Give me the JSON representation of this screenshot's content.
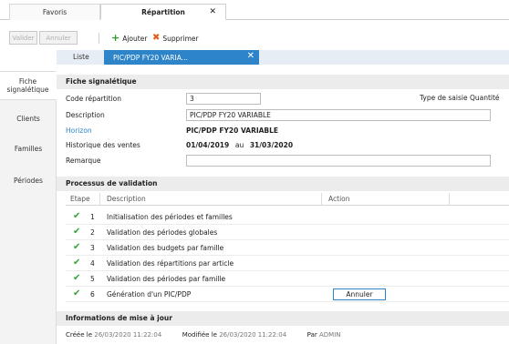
{
  "tabs": {
    "favoris": "Favoris",
    "repartition": "Répartition",
    "close": "✕"
  },
  "toolbar": {
    "valider": "Valider",
    "annuler": "Annuler",
    "ajouter": "Ajouter",
    "supprimer": "Supprimer"
  },
  "liste": {
    "label": "Liste",
    "chip": "PIC/PDP FY20 VARIA...",
    "chip_close": "✕"
  },
  "sidebar": {
    "items": [
      {
        "label": "Fiche signalétique"
      },
      {
        "label": "Clients"
      },
      {
        "label": "Familles"
      },
      {
        "label": "Périodes"
      }
    ]
  },
  "fiche": {
    "title": "Fiche signalétique",
    "code_label": "Code répartition",
    "code_value": "3",
    "saisie_label": "Type de saisie",
    "saisie_value": "Quantité",
    "description_label": "Description",
    "description_value": "PIC/PDP FY20 VARIABLE",
    "horizon_label": "Horizon",
    "horizon_value": "PIC/PDP FY20 VARIABLE",
    "historique_label": "Historique des ventes",
    "historique_from": "01/04/2019",
    "historique_au": "au",
    "historique_to": "31/03/2020",
    "remarque_label": "Remarque",
    "remarque_value": ""
  },
  "process": {
    "title": "Processus de validation",
    "headers": {
      "etape": "Etape",
      "description": "Description",
      "action": "Action"
    },
    "rows": [
      {
        "num": "1",
        "description": "Initialisation des périodes et familles"
      },
      {
        "num": "2",
        "description": "Validation des périodes globales"
      },
      {
        "num": "3",
        "description": "Validation des budgets par famille"
      },
      {
        "num": "4",
        "description": "Validation des répartitions par article"
      },
      {
        "num": "5",
        "description": "Validation des périodes par famille"
      },
      {
        "num": "6",
        "description": "Génération d'un PIC/PDP"
      }
    ],
    "row6_action": "Annuler"
  },
  "info": {
    "title": "Informations de mise à jour",
    "creee_label": "Créée le",
    "creee_value": "26/03/2020 11:22:04",
    "modifiee_label": "Modifiée le",
    "modifiee_value": "26/03/2020 11:22:04",
    "par_label": "Par",
    "par_value": "ADMIN"
  },
  "colors": {
    "accent": "#2e84c8",
    "check": "#36a336",
    "add": "#2e9b2e",
    "delete": "#e35a1a"
  }
}
